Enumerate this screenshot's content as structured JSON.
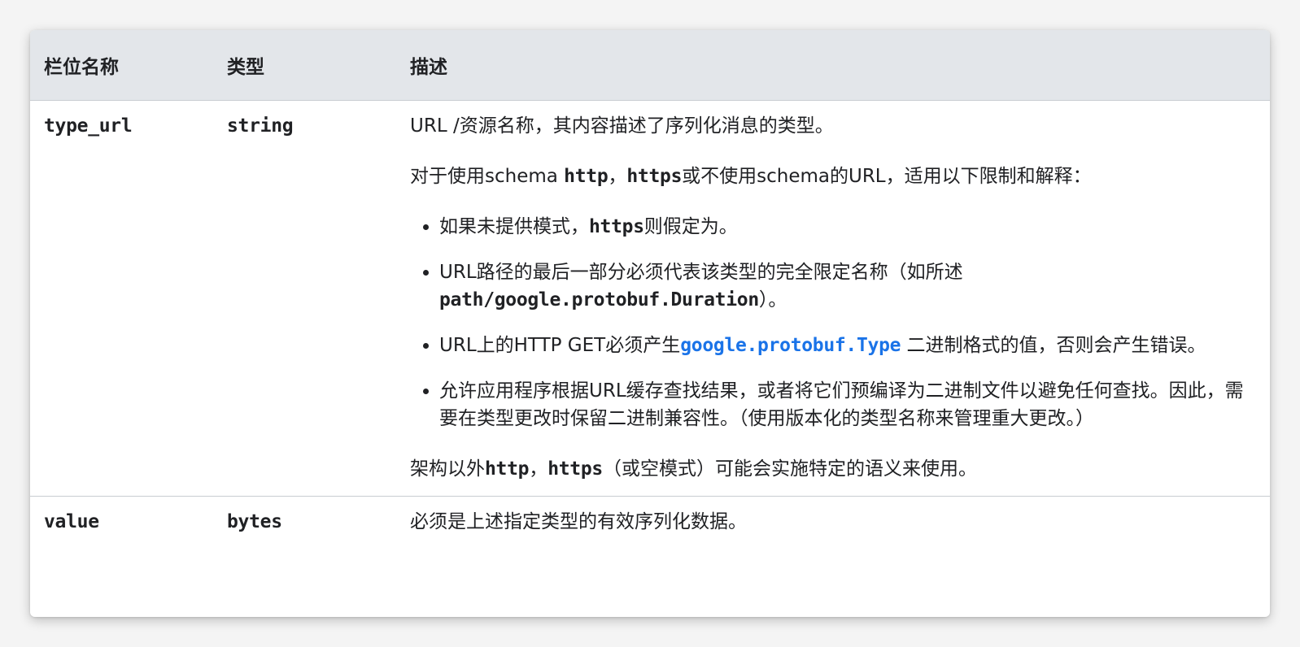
{
  "table": {
    "headers": [
      "栏位名称",
      "类型",
      "描述"
    ],
    "rows": [
      {
        "field": "type_url",
        "type": "string",
        "description": {
          "p1": "URL /资源名称，其内容描述了序列化消息的类型。",
          "p2": {
            "a": "对于使用schema ",
            "b": "http",
            "c": "，",
            "d": "https",
            "e": "或不使用schema的URL，适用以下限制和解释："
          },
          "bullets": [
            {
              "a": "如果未提供模式，",
              "b": "https",
              "c": "则假定为。"
            },
            {
              "a": "URL路径的最后一部分必须代表该类型的完全限定名称（如所述",
              "b": "path/google.protobuf.Duration",
              "c": "）。"
            },
            {
              "a": "URL上的HTTP GET必须产生",
              "b": "google.protobuf.Type",
              "c": " 二进制格式的值，否则会产生错误。"
            },
            {
              "a": "允许应用程序根据URL缓存查找结果，或者将它们预编译为二进制文件以避免任何查找。因此，需要在类型更改时保留二进制兼容性。（使用版本化的类型名称来管理重大更改。）"
            }
          ],
          "p3": {
            "a": "架构以外",
            "b": "http",
            "c": "，",
            "d": "https",
            "e": "（或空模式）可能会实施特定的语义来使用。"
          }
        }
      },
      {
        "field": "value",
        "type": "bytes",
        "description": "必须是上述指定类型的有效序列化数据。"
      }
    ]
  },
  "colors": {
    "header_bg": "#e3e6ea",
    "link": "#1a73e8",
    "text": "#202124"
  }
}
